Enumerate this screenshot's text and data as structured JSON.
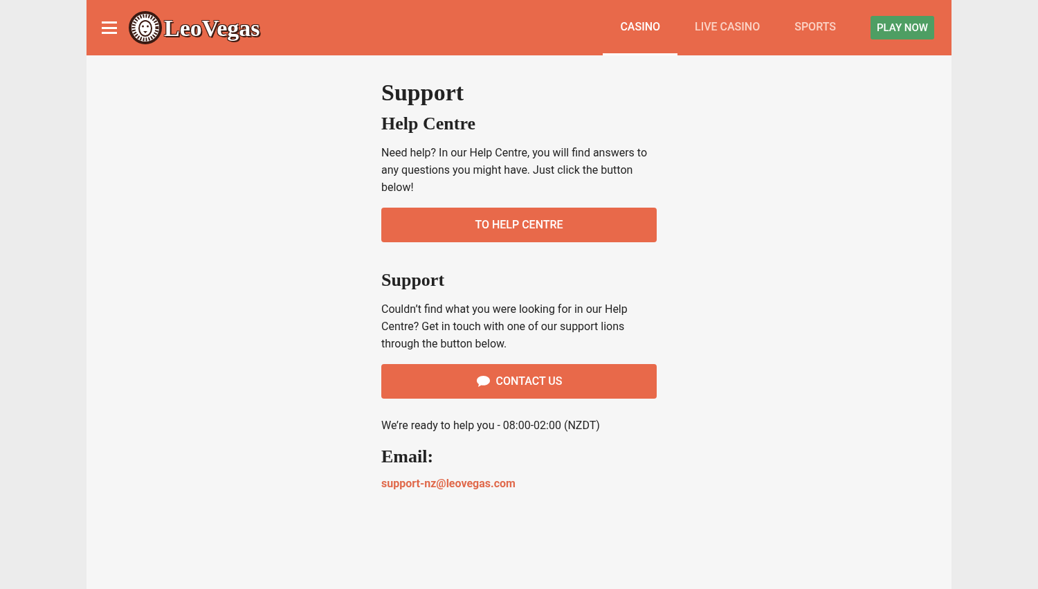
{
  "header": {
    "logo": "LeoVegas",
    "nav": [
      {
        "label": "CASINO",
        "selected": true
      },
      {
        "label": "LIVE CASINO",
        "selected": false
      },
      {
        "label": "SPORTS",
        "selected": false
      }
    ],
    "cta": "PLAY NOW"
  },
  "title": "Support",
  "sections": [
    {
      "heading": "Help Centre",
      "text": "Need help? In our Help Centre, you will find answers to any questions you might have. Just click the button below!",
      "button": {
        "label": "TO HELP CENTRE",
        "icon": false
      }
    },
    {
      "heading": "Support",
      "text": "Couldn’t find what you were looking for in our Help Centre? Get in touch with one of our support lions through the button below.",
      "button": {
        "label": "CONTACT US",
        "icon": true
      }
    }
  ],
  "hours": "We’re ready to help you - 08:00-02:00 (NZDT)",
  "email": {
    "heading": "Email:",
    "address": "support-nz@leovegas.com"
  }
}
